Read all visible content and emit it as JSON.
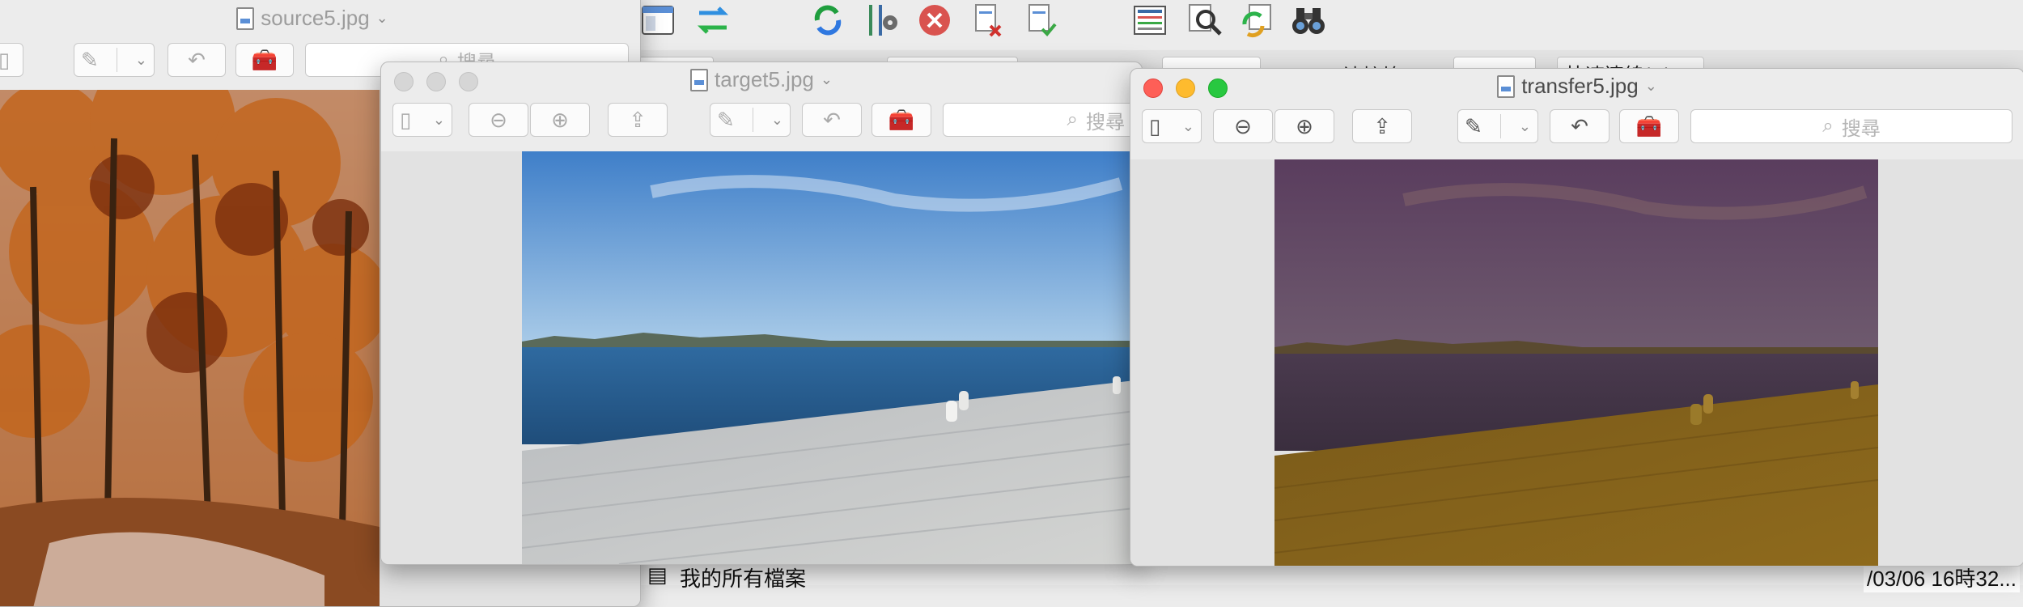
{
  "windows": {
    "source": {
      "title": "source5.jpg",
      "search_placeholder": "搜尋"
    },
    "target": {
      "title": "target5.jpg",
      "search_placeholder": "搜尋"
    },
    "transfer": {
      "title": "transfer5.jpg",
      "search_placeholder": "搜尋"
    }
  },
  "background_app": {
    "label1": "連接埠(P)",
    "label2": "快速連線(Q)",
    "status_text": "我的所有檔案",
    "date_text": "/03/06 16時32..."
  },
  "icons": {
    "toolbar": [
      "panel-icon",
      "swap-arrows-icon",
      "refresh-icon",
      "settings-sliders-icon",
      "stop-icon",
      "delete-file-icon",
      "verify-file-icon",
      "list-icon",
      "search-icon",
      "sync-icon",
      "binoculars-icon"
    ],
    "window": [
      "sidebar-icon",
      "zoom-out-icon",
      "zoom-in-icon",
      "share-icon",
      "markup-pen-icon",
      "rotate-icon",
      "toolbox-icon",
      "search-icon"
    ]
  },
  "colors": {
    "close": "#fe5f57",
    "minimize": "#febb2e",
    "maximize": "#28c840"
  }
}
